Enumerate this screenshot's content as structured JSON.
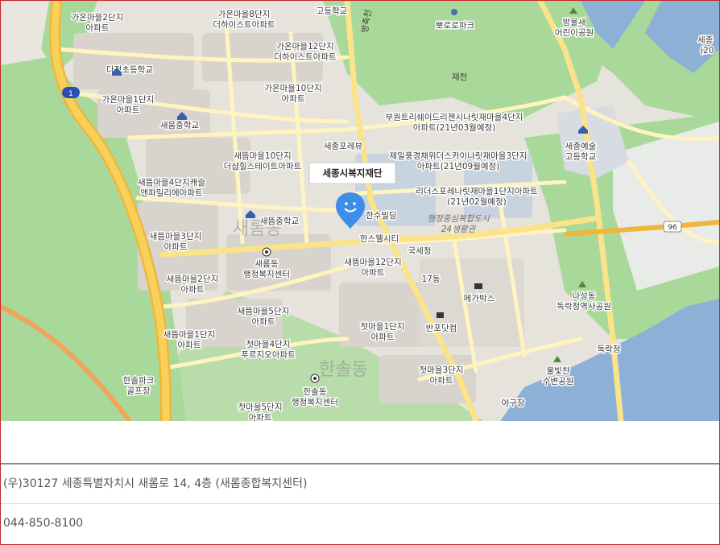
{
  "map": {
    "popup_title": "세종시복지재단",
    "labels": {
      "gaon2": [
        "가온마을2단지",
        "아파트"
      ],
      "gaon8": [
        "가온마을8단지",
        "더하이스트아파트"
      ],
      "gaon12": [
        "가온마을12단지",
        "더하이스트아파트"
      ],
      "gaon10": [
        "가온마을10단지",
        "아파트"
      ],
      "gaon1": [
        "가온마을1단지",
        "아파트"
      ],
      "dajeong_school": "다정초등학교",
      "saeum_mid": "새움중학교",
      "high_school_top": "고등학교",
      "pororo": "뽀로로파크",
      "bangulsae": [
        "방울새",
        "어린이공원"
      ],
      "buwon": [
        "부원트리쉐이드리젠시나릿재마을4단지",
        "아파트(21년03월예정)"
      ],
      "sejong_forum": "세종포레뷰",
      "jeil": [
        "제일풍경채위더스카이나릿재마을3단지",
        "아파트(21년09월예정)"
      ],
      "sejong_arts": [
        "세종예술",
        "고등학교"
      ],
      "saetteum10": [
        "새뜸마을10단지",
        "더샵힐스테이트아파트"
      ],
      "saetteum4": [
        "새뜸마을4단지캐슬",
        "앤파밀리에아파트"
      ],
      "saetteum_mid": "새뜸중학교",
      "saerom_big": "새롬동",
      "hansu": "한수빌딩",
      "liberty": [
        "리더스포레나릿재마을1단지아파트",
        "(21년02월예정)"
      ],
      "admin_center": [
        "행정중심복합도시",
        "24생활권"
      ],
      "hanswell": "한스웰시티",
      "saetteum3": [
        "새뜸마을3단지",
        "아파트"
      ],
      "saerom_office": [
        "새롬동",
        "행정복지센터"
      ],
      "saetteum12": [
        "새뜸마을12단지",
        "아파트"
      ],
      "tax": "국세청",
      "dong17": "17동",
      "saetteum2": [
        "새뜸마을2단지",
        "아파트"
      ],
      "megabox": "메가박스",
      "nasung": [
        "나성동",
        "독락정역사공원"
      ],
      "saetteum5": [
        "새뜸마을5단지",
        "아파트"
      ],
      "saetteum1": [
        "새뜸마을1단지",
        "아파트"
      ],
      "cheotmaeul1": [
        "첫마을1단지",
        "아파트"
      ],
      "banpo": "반포닷컴",
      "cheotmaeul4": [
        "첫마을4단지",
        "푸르지오아파트"
      ],
      "dokrakjeong": "독락정",
      "hansol_big": "한솔동",
      "cheotmaeul3": [
        "첫마을3단지",
        "아파트"
      ],
      "hansolpark": [
        "한솔파크",
        "골프장"
      ],
      "hansol_office": [
        "한솔동",
        "행정복지센터"
      ],
      "mulbitchan": [
        "물빛찬",
        "수변공원"
      ],
      "cheotmaeul5": [
        "첫마을5단지",
        "아파트"
      ],
      "baseball": "야구장",
      "sejong_right": "세종",
      "right_20": "(20",
      "road_jaechon": "재천",
      "road_bangchuk": "방축천",
      "road_jeonwol": "전월천",
      "shield_1": "1",
      "shield_96": "96"
    }
  },
  "info": {
    "address": "(우)30127 세종특별자치시 새롬로 14, 4층 (새롬종합복지센터)",
    "phone": "044-850-8100"
  },
  "colors": {
    "border": "#c0262b",
    "urban": "#e7e3de",
    "green": "#a8d99a",
    "water": "#8ab0d6",
    "road_yellow": "#fbe38a",
    "highway": "#f6c541",
    "pin": "#3d8ee8"
  }
}
